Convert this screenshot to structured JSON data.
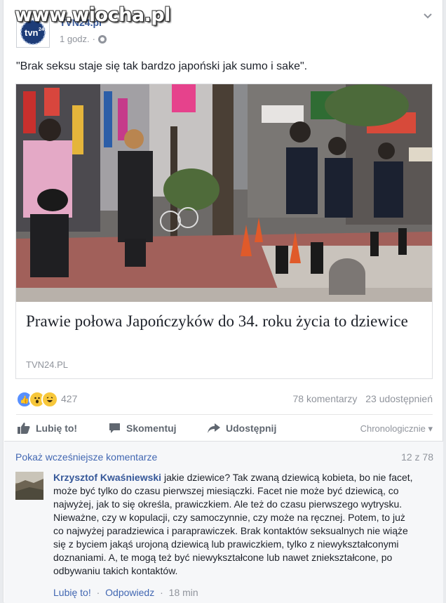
{
  "watermark": "www.wiocha.pl",
  "post": {
    "page_name": "TVN24.pl",
    "time": "1 godz.",
    "privacy_icon": "globe-icon",
    "menu_icon": "chevron-down-icon",
    "text": "\"Brak seksu staje się tak bardzo japoński jak sumo i sake\"."
  },
  "link": {
    "title": "Prawie połowa Japończyków do 34. roku życia to dziewice",
    "domain": "TVN24.PL"
  },
  "reactions": {
    "icons": [
      "like-icon",
      "wow-icon",
      "haha-icon"
    ],
    "count": "427",
    "comments": "78 komentarzy",
    "shares": "23 udostępnień"
  },
  "actions": {
    "like": "Lubię to!",
    "comment": "Skomentuj",
    "share": "Udostępnij",
    "sort": "Chronologicznie"
  },
  "comments": {
    "show_previous": "Pokaż wcześniejsze komentarze",
    "count": "12 z 78",
    "items": [
      {
        "author": "Krzysztof Kwaśniewski",
        "text": "jakie dziewice? Tak zwaną dziewicą kobieta, bo nie facet, może być tylko do czasu pierwszej miesiączki. Facet nie może być dziewicą, co najwyżej, jak to się określa, prawiczkiem. Ale też do czasu pierwszego wytrysku. Nieważne, czy w kopulacji, czy samoczynnie, czy może na ręcznej. Potem, to już co najwyżej paradziewica i paraprawiczek. Brak kontaktów seksualnych nie wiąże się z byciem jakąś urojoną dziewicą lub prawiczkiem, tylko z niewykształconymi doznaniami. A, te mogą też być niewykształcone lub nawet zniekształcone, po odbywaniu takich kontaktów.",
        "like": "Lubię to!",
        "reply": "Odpowiedz",
        "time": "18 min"
      }
    ]
  }
}
